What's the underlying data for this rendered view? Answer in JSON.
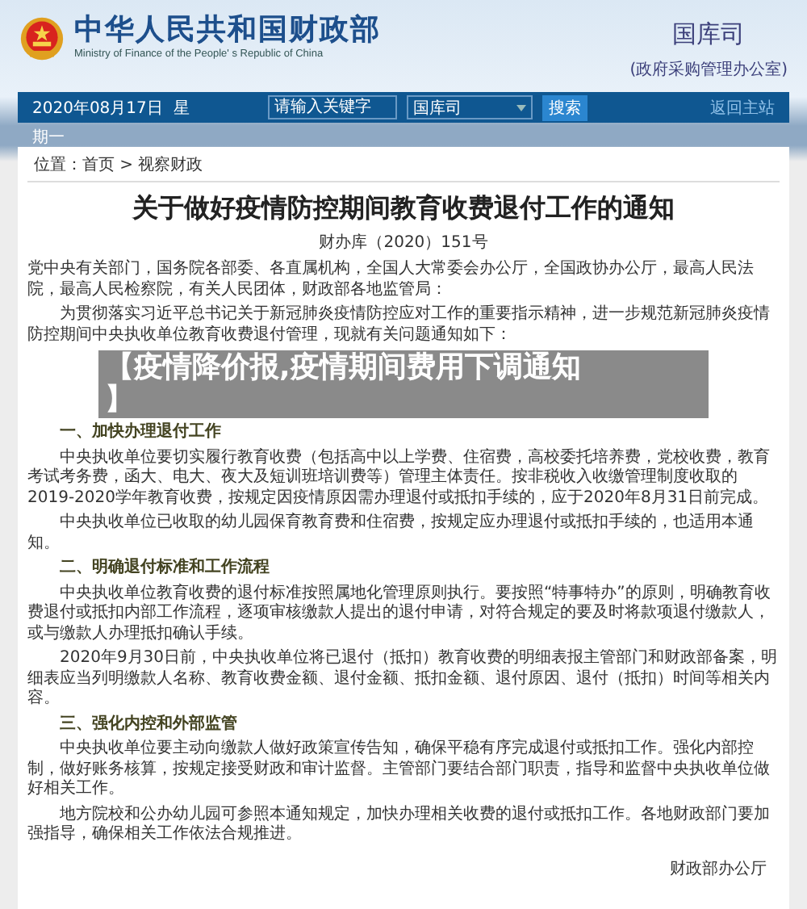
{
  "header": {
    "title": "中华人民共和国财政部",
    "subtitle": "Ministry of Finance of the People' s Republic of China",
    "department": "国库司",
    "department_note": "(政府采购管理办公室)"
  },
  "nav": {
    "date": "2020年08月17日  星",
    "date_wrap": "期一",
    "search_placeholder": "请输入关键字",
    "scope": "国库司",
    "search_button": "搜索",
    "home_link": "返回主站"
  },
  "breadcrumb": "位置：首页 > 视察财政",
  "article": {
    "title": "关于做好疫情防控期间教育收费退付工作的通知",
    "doc_number": "财办库（2020）151号",
    "blocks": [
      {
        "kind": "salutation",
        "text": "党中央有关部门，国务院各部委、各直属机构，全国人大常委会办公厅，全国政协办公厅，最高人民法院，最高人民检察院，有关人民团体，财政部各地监管局："
      },
      {
        "kind": "paragraph",
        "text": "为贯彻落实习近平总书记关于新冠肺炎疫情防控应对工作的重要指示精神，进一步规范新冠肺炎疫情防控期间中央执收单位教育收费退付管理，现就有关问题通知如下："
      },
      {
        "kind": "heading",
        "text": "一、加快办理退付工作"
      },
      {
        "kind": "paragraph",
        "text": "中央执收单位要切实履行教育收费（包括高中以上学费、住宿费，高校委托培养费，党校收费，教育考试考务费，函大、电大、夜大及短训班培训费等）管理主体责任。按非税收入收缴管理制度收取的2019-2020学年教育收费，按规定因疫情原因需办理退付或抵扣手续的，应于2020年8月31日前完成。"
      },
      {
        "kind": "paragraph",
        "text": "中央执收单位已收取的幼儿园保育教育费和住宿费，按规定应办理退付或抵扣手续的，也适用本通知。"
      },
      {
        "kind": "heading",
        "text": "二、明确退付标准和工作流程"
      },
      {
        "kind": "paragraph",
        "text": "中央执收单位教育收费的退付标准按照属地化管理原则执行。要按照“特事特办”的原则，明确教育收费退付或抵扣内部工作流程，逐项审核缴款人提出的退付申请，对符合规定的要及时将款项退付缴款人，或与缴款人办理抵扣确认手续。"
      },
      {
        "kind": "paragraph",
        "text": "2020年9月30日前，中央执收单位将已退付（抵扣）教育收费的明细表报主管部门和财政部备案，明细表应当列明缴款人名称、教育收费金额、退付金额、抵扣金额、退付原因、退付（抵扣）时间等相关内容。"
      },
      {
        "kind": "heading",
        "text": "三、强化内控和外部监管"
      },
      {
        "kind": "paragraph",
        "text": "中央执收单位要主动向缴款人做好政策宣传告知，确保平稳有序完成退付或抵扣工作。强化内部控制，做好账务核算，按规定接受财政和审计监督。主管部门要结合部门职责，指导和监督中央执收单位做好相关工作。"
      },
      {
        "kind": "paragraph",
        "text": "地方院校和公办幼儿园可参照本通知规定，加快办理相关收费的退付或抵扣工作。各地财政部门要加强指导，确保相关工作依法合规推进。"
      }
    ],
    "signature": "财政部办公厅"
  },
  "overlay_caption": [
    "【疫情降价报,疫情期间费用下调通知",
    "】"
  ]
}
